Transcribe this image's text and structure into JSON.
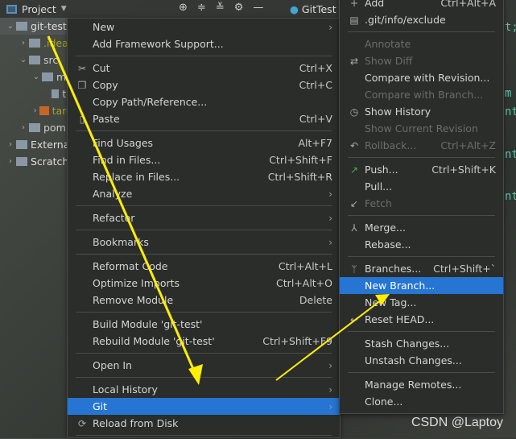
{
  "topbar": {
    "title": "Project",
    "tab": "GitTest"
  },
  "tree": [
    "git-test",
    ".idea",
    "src",
    "m",
    "te",
    "targ",
    "pom",
    "Externa",
    "Scratch"
  ],
  "code": [
    "t;",
    "m",
    "nt",
    "nt",
    "nt"
  ],
  "left_menu": [
    {
      "label": "New",
      "sub": true
    },
    {
      "label": "Add Framework Support..."
    },
    {
      "sep": true
    },
    {
      "label": "Cut",
      "sc": "Ctrl+X",
      "icon": "scissors-icon",
      "g": "✂"
    },
    {
      "label": "Copy",
      "sc": "Ctrl+C",
      "icon": "copy-icon",
      "g": "❐"
    },
    {
      "label": "Copy Path/Reference..."
    },
    {
      "label": "Paste",
      "sc": "Ctrl+V",
      "icon": "paste-icon",
      "g": "▯"
    },
    {
      "sep": true
    },
    {
      "label": "Find Usages",
      "sc": "Alt+F7"
    },
    {
      "label": "Find in Files...",
      "sc": "Ctrl+Shift+F"
    },
    {
      "label": "Replace in Files...",
      "sc": "Ctrl+Shift+R"
    },
    {
      "label": "Analyze",
      "sub": true
    },
    {
      "sep": true
    },
    {
      "label": "Refactor",
      "sub": true
    },
    {
      "sep": true
    },
    {
      "label": "Bookmarks",
      "sub": true
    },
    {
      "sep": true
    },
    {
      "label": "Reformat Code",
      "sc": "Ctrl+Alt+L"
    },
    {
      "label": "Optimize Imports",
      "sc": "Ctrl+Alt+O"
    },
    {
      "label": "Remove Module",
      "sc": "Delete"
    },
    {
      "sep": true
    },
    {
      "label": "Build Module 'git-test'"
    },
    {
      "label": "Rebuild Module 'git-test'",
      "sc": "Ctrl+Shift+F9"
    },
    {
      "sep": true
    },
    {
      "label": "Open In",
      "sub": true
    },
    {
      "sep": true
    },
    {
      "label": "Local History",
      "sub": true
    },
    {
      "label": "Git",
      "sub": true,
      "sel": true
    },
    {
      "label": "Reload from Disk",
      "icon": "reload-icon",
      "g": "⟳"
    },
    {
      "sep": true
    }
  ],
  "git_menu": [
    {
      "label": "Add",
      "sc": "Ctrl+Alt+A",
      "icon": "plus-icon",
      "g": "+"
    },
    {
      "label": ".git/info/exclude",
      "icon": "file-ignore-icon",
      "g": "▤"
    },
    {
      "sep": true
    },
    {
      "label": "Annotate",
      "dis": true
    },
    {
      "label": "Show Diff",
      "dis": true,
      "icon": "diff-icon",
      "g": "⇄"
    },
    {
      "label": "Compare with Revision..."
    },
    {
      "label": "Compare with Branch...",
      "dis": true
    },
    {
      "label": "Show History",
      "icon": "clock-icon",
      "g": "◷"
    },
    {
      "label": "Show Current Revision",
      "dis": true
    },
    {
      "label": "Rollback...",
      "sc": "Ctrl+Alt+Z",
      "dis": true,
      "icon": "rollback-icon",
      "g": "↶"
    },
    {
      "sep": true
    },
    {
      "label": "Push...",
      "sc": "Ctrl+Shift+K",
      "icon": "push-arrow-icon",
      "g": "↗"
    },
    {
      "label": "Pull..."
    },
    {
      "label": "Fetch",
      "dis": true,
      "icon": "fetch-icon",
      "g": "↙"
    },
    {
      "sep": true
    },
    {
      "label": "Merge...",
      "icon": "merge-icon",
      "g": "⅄"
    },
    {
      "label": "Rebase..."
    },
    {
      "sep": true
    },
    {
      "label": "Branches...",
      "sc": "Ctrl+Shift+`",
      "icon": "branch-icon",
      "g": "ᛘ"
    },
    {
      "label": "New Branch...",
      "sel": true
    },
    {
      "label": "New Tag..."
    },
    {
      "label": "Reset HEAD...",
      "icon": "reset-icon",
      "g": "↩"
    },
    {
      "sep": true
    },
    {
      "label": "Stash Changes..."
    },
    {
      "label": "Unstash Changes..."
    },
    {
      "sep": true
    },
    {
      "label": "Manage Remotes..."
    },
    {
      "label": "Clone..."
    }
  ],
  "watermark": "CSDN @Laptoy",
  "colors": {
    "selection": "#2675d3",
    "menu_bg": "#2b2d2b",
    "annotation_arrow": "#ffee00",
    "push_icon": "#4caf50"
  }
}
